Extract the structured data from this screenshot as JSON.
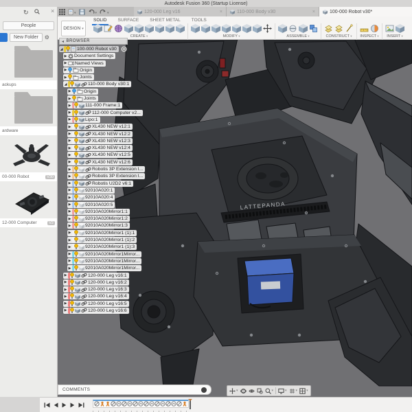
{
  "colors": {
    "accent_blue": "#1f6fd0",
    "viewport_bg": "#707073",
    "battery_blue": "#3f63b5",
    "timeline_bar_blue": "#5b9bd5",
    "joint_orange": "#d9822b",
    "bulb_yellow": "#f2b705",
    "bulb_blue": "#44a0e8",
    "red_accent": "#8c2525"
  },
  "titlebar": {
    "title": "Autodesk Fusion 360 (Startup License)"
  },
  "quick_access": {
    "icons": [
      "data-panel-grid-icon",
      "file-new-icon",
      "save-icon",
      "undo-icon",
      "redo-icon"
    ]
  },
  "doc_tabs": [
    {
      "label": "120-000 Leg v16",
      "active": false,
      "closable": true
    },
    {
      "label": "110-000 Body v30",
      "active": false,
      "closable": true
    },
    {
      "label": "100-000 Robot v30*",
      "active": true,
      "closable": false
    }
  ],
  "toolbar": {
    "design_label": "DESIGN",
    "tabs": [
      "SOLID",
      "SURFACE",
      "SHEET METAL",
      "TOOLS"
    ],
    "active_tab": "SOLID",
    "groups": [
      {
        "label": "CREATE",
        "icons": [
          "new-component",
          "create-sketch",
          "create-form",
          "extrude",
          "revolve",
          "sweep",
          "loft",
          "rib",
          "hole"
        ]
      },
      {
        "label": "MODIFY",
        "icons": [
          "press-pull",
          "fillet",
          "chamfer",
          "shell",
          "draft",
          "scale",
          "combine",
          "move"
        ]
      },
      {
        "label": "ASSEMBLE",
        "icons": [
          "new-component",
          "joint",
          "as-built-joint",
          "rigid-group"
        ]
      },
      {
        "label": "CONSTRUCT",
        "icons": [
          "offset-plane",
          "midplane",
          "axis"
        ]
      },
      {
        "label": "INSPECT",
        "icons": [
          "measure",
          "section-analysis"
        ]
      },
      {
        "label": "INSERT",
        "icons": [
          "insert-image",
          "insert-mesh"
        ]
      }
    ]
  },
  "data_panel": {
    "people_label": "People",
    "new_folder_label": "New Folder",
    "items": [
      {
        "type": "folder",
        "label": "ackups",
        "badge": ""
      },
      {
        "type": "folder",
        "label": "ardware",
        "badge": ""
      },
      {
        "type": "robot",
        "label": "00-000 Robot",
        "badge": "V30"
      },
      {
        "type": "board",
        "label": "12-000 Computer",
        "badge": "V2"
      }
    ]
  },
  "browser": {
    "header": "BROWSER",
    "rows": [
      {
        "label": "100-000 Robot v30",
        "level": 0,
        "arrow": "expanded",
        "bulb": "yellow",
        "icon": "doc",
        "link": false,
        "strip": "#e8c93e",
        "root": true
      },
      {
        "label": "Document Settings",
        "level": 1,
        "arrow": "collapsed",
        "bulb": null,
        "icon": "gear",
        "link": false,
        "strip": null
      },
      {
        "label": "Named Views",
        "level": 1,
        "arrow": "collapsed",
        "bulb": null,
        "icon": "views",
        "link": false,
        "strip": null
      },
      {
        "label": "Origin",
        "level": 1,
        "arrow": "collapsed",
        "bulb": "blue",
        "icon": "folder",
        "link": false,
        "strip": null
      },
      {
        "label": "Joints",
        "level": 1,
        "arrow": "collapsed",
        "bulb": "yellow",
        "icon": "folder",
        "link": false,
        "strip": null
      },
      {
        "label": "110-000 Body v30:1",
        "level": 1,
        "arrow": "expanded",
        "bulb": "yellow",
        "icon": "component",
        "link": true,
        "strip": "#e8c93e"
      },
      {
        "label": "Origin",
        "level": 2,
        "arrow": "collapsed",
        "bulb": "blue",
        "icon": "folder",
        "link": false,
        "strip": null
      },
      {
        "label": "Joints",
        "level": 2,
        "arrow": "collapsed",
        "bulb": "yellow",
        "icon": "folder",
        "link": false,
        "strip": null
      },
      {
        "label": "111-000 Frame:1",
        "level": 2,
        "arrow": "collapsed",
        "bulb": "yellow",
        "icon": "component",
        "link": false,
        "strip": "#f0a0a0"
      },
      {
        "label": "112-000 Computer v2...",
        "level": 2,
        "arrow": "collapsed",
        "bulb": "yellow",
        "icon": "component",
        "link": true,
        "strip": "#e8c93e"
      },
      {
        "label": "Lipo:1",
        "level": 2,
        "arrow": "collapsed",
        "bulb": "yellow",
        "icon": "component",
        "link": false,
        "strip": "#f0a0a0"
      },
      {
        "label": "XL430 NEW v12:1",
        "level": 2,
        "arrow": "collapsed",
        "bulb": "yellow",
        "icon": "component",
        "link": true,
        "strip": "#f2f2f2"
      },
      {
        "label": "XL430 NEW v12:2",
        "level": 2,
        "arrow": "collapsed",
        "bulb": "yellow",
        "icon": "component",
        "link": true,
        "strip": "#f2f2f2"
      },
      {
        "label": "XL430 NEW v12:3",
        "level": 2,
        "arrow": "collapsed",
        "bulb": "yellow",
        "icon": "component",
        "link": true,
        "strip": "#f2f2f2"
      },
      {
        "label": "XL430 NEW v12:4",
        "level": 2,
        "arrow": "collapsed",
        "bulb": "yellow",
        "icon": "component",
        "link": true,
        "strip": "#f2f2f2"
      },
      {
        "label": "XL430 NEW v12:5",
        "level": 2,
        "arrow": "collapsed",
        "bulb": "yellow",
        "icon": "component",
        "link": true,
        "strip": "#f2f2f2"
      },
      {
        "label": "XL430 NEW v12:6",
        "level": 2,
        "arrow": "collapsed",
        "bulb": "yellow",
        "icon": "component",
        "link": true,
        "strip": "#f2f2f2"
      },
      {
        "label": "Robotis 3P Extension I...",
        "level": 2,
        "arrow": "collapsed",
        "bulb": "yellow",
        "icon": "body",
        "link": true,
        "strip": "#f0c8a0"
      },
      {
        "label": "Robotis 3P Extension I...",
        "level": 2,
        "arrow": "collapsed",
        "bulb": "yellow",
        "icon": "body",
        "link": true,
        "strip": "#f0c8a0"
      },
      {
        "label": "Robotis U2D2 v6:1",
        "level": 2,
        "arrow": "collapsed",
        "bulb": "yellow",
        "icon": "component",
        "link": true,
        "strip": "#a8c8f0"
      },
      {
        "label": "92010A020:1",
        "level": 2,
        "arrow": "collapsed",
        "bulb": "yellow",
        "icon": "body",
        "link": false,
        "strip": "#a8c8f0"
      },
      {
        "label": "92010A020:4",
        "level": 2,
        "arrow": "collapsed",
        "bulb": "yellow",
        "icon": "body",
        "link": false,
        "strip": "#a8c8f0"
      },
      {
        "label": "92010A020:5",
        "level": 2,
        "arrow": "collapsed",
        "bulb": "yellow",
        "icon": "body",
        "link": false,
        "strip": "#a8c8f0"
      },
      {
        "label": "92010A020Mirror1:1",
        "level": 2,
        "arrow": "collapsed",
        "bulb": "yellow",
        "icon": "body",
        "link": false,
        "strip": "#f0a0a0"
      },
      {
        "label": "92010A020Mirror1:2",
        "level": 2,
        "arrow": "collapsed",
        "bulb": "yellow",
        "icon": "body",
        "link": false,
        "strip": "#f0a0a0"
      },
      {
        "label": "92010A020Mirror1:3",
        "level": 2,
        "arrow": "collapsed",
        "bulb": "yellow",
        "icon": "body",
        "link": false,
        "strip": "#f0a0a0"
      },
      {
        "label": "92010A020Mirror1 (1):1",
        "level": 2,
        "arrow": "collapsed",
        "bulb": "yellow",
        "icon": "body",
        "link": false,
        "strip": "#f2f2f2"
      },
      {
        "label": "92010A020Mirror1 (1):2",
        "level": 2,
        "arrow": "collapsed",
        "bulb": "yellow",
        "icon": "body",
        "link": false,
        "strip": "#f2f2f2"
      },
      {
        "label": "92010A020Mirror1 (1):3",
        "level": 2,
        "arrow": "collapsed",
        "bulb": "yellow",
        "icon": "body",
        "link": false,
        "strip": "#f2f2f2"
      },
      {
        "label": "92010A020Mirror1Mirror...",
        "level": 2,
        "arrow": "collapsed",
        "bulb": "yellow",
        "icon": "body",
        "link": false,
        "strip": "#7fd8e8"
      },
      {
        "label": "92010A020Mirror1Mirror...",
        "level": 2,
        "arrow": "collapsed",
        "bulb": "yellow",
        "icon": "body",
        "link": false,
        "strip": "#7fd8e8"
      },
      {
        "label": "92010A020Mirror1Mirror...",
        "level": 2,
        "arrow": "collapsed",
        "bulb": "yellow",
        "icon": "body",
        "link": false,
        "strip": "#7fd8e8"
      },
      {
        "label": "120-000 Leg v16:1",
        "level": 1,
        "arrow": "collapsed",
        "bulb": "yellow",
        "icon": "component",
        "link": true,
        "strip": "#f08080"
      },
      {
        "label": "120-000 Leg v16:2",
        "level": 1,
        "arrow": "collapsed",
        "bulb": "yellow",
        "icon": "component",
        "link": true,
        "strip": "#f08080"
      },
      {
        "label": "120-000 Leg v16:3",
        "level": 1,
        "arrow": "collapsed",
        "bulb": "yellow",
        "icon": "component",
        "link": true,
        "strip": "#f08080"
      },
      {
        "label": "120-000 Leg v16:4",
        "level": 1,
        "arrow": "collapsed",
        "bulb": "yellow",
        "icon": "component",
        "link": true,
        "strip": "#f08080"
      },
      {
        "label": "120-000 Leg v16:5",
        "level": 1,
        "arrow": "collapsed",
        "bulb": "yellow",
        "icon": "component",
        "link": true,
        "strip": "#f08080"
      },
      {
        "label": "120-000 Leg v16:6",
        "level": 1,
        "arrow": "collapsed",
        "bulb": "yellow",
        "icon": "component",
        "link": true,
        "strip": "#f08080"
      }
    ]
  },
  "comments": {
    "label": "COMMENTS"
  },
  "navbar": {
    "icons": [
      {
        "name": "pan-icon",
        "dropdown": true
      },
      {
        "name": "orbit-icon",
        "dropdown": false
      },
      {
        "name": "look-at-icon",
        "dropdown": false
      },
      {
        "name": "zoom-window-icon",
        "dropdown": false
      },
      {
        "name": "zoom-icon",
        "dropdown": true
      },
      {
        "name": "separator",
        "dropdown": false
      },
      {
        "name": "display-settings-icon",
        "dropdown": true
      },
      {
        "name": "grid-snaps-icon",
        "dropdown": true
      },
      {
        "name": "viewports-icon",
        "dropdown": true
      }
    ]
  },
  "timeline": {
    "playback": [
      "go-to-start",
      "step-back",
      "play",
      "step-forward",
      "go-to-end"
    ],
    "items": [
      "feature",
      "joint",
      "joint",
      "feature",
      "motion",
      "feature",
      "motion",
      "feature",
      "motion",
      "feature",
      "motion",
      "feature",
      "motion",
      "feature",
      "motion",
      "feature",
      "joint"
    ]
  }
}
